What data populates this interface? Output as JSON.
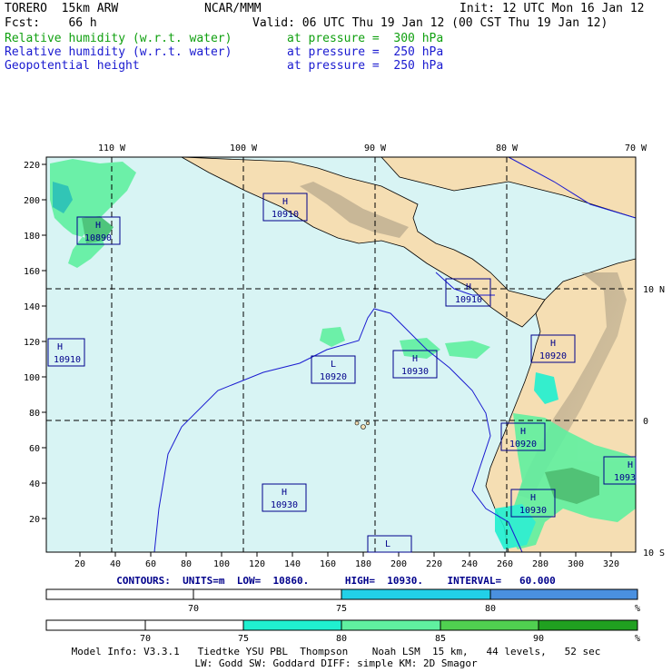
{
  "header": {
    "model": "TORERO  15km ARW",
    "org": "NCAR/MMM",
    "init": "Init: 12 UTC Mon 16 Jan 12",
    "fcst": "Fcst:    66 h",
    "valid": "Valid: 06 UTC Thu 19 Jan 12 (00 CST Thu 19 Jan 12)",
    "fields": [
      {
        "name": "Relative humidity (w.r.t. water)",
        "level": "at pressure =  300 hPa",
        "color": "#10a010"
      },
      {
        "name": "Relative humidity (w.r.t. water)",
        "level": "at pressure =  250 hPa",
        "color": "#1a1ad0"
      },
      {
        "name": "Geopotential height",
        "level": "at pressure =  250 hPa",
        "color": "#1a1ad0"
      }
    ]
  },
  "map": {
    "ocean_color": "#d8f4f4",
    "land_color": "#f5deb3",
    "top_lon_labels": [
      "110 W",
      "100 W",
      "90 W",
      "80 W",
      "70 W"
    ],
    "right_lat_labels": [
      "10 N",
      "0",
      "10 S"
    ],
    "left_ticks": [
      "220",
      "200",
      "180",
      "160",
      "140",
      "120",
      "100",
      "80",
      "60",
      "40",
      "20"
    ],
    "bottom_ticks": [
      "20",
      "40",
      "60",
      "80",
      "100",
      "120",
      "140",
      "160",
      "180",
      "200",
      "220",
      "240",
      "260",
      "280",
      "300",
      "320"
    ],
    "centers": [
      {
        "type": "H",
        "value": "10890"
      },
      {
        "type": "H",
        "value": "10910"
      },
      {
        "type": "H",
        "value": "10910"
      },
      {
        "type": "H",
        "value": "10910"
      },
      {
        "type": "L",
        "value": "10920"
      },
      {
        "type": "H",
        "value": "10930"
      },
      {
        "type": "H",
        "value": "10920"
      },
      {
        "type": "H",
        "value": "10920"
      },
      {
        "type": "H",
        "value": "10930"
      },
      {
        "type": "H",
        "value": "10930"
      },
      {
        "type": "H",
        "value": "1093"
      },
      {
        "type": "L",
        "value": ""
      }
    ]
  },
  "contours_line": "CONTOURS:  UNITS=m  LOW=  10860.      HIGH=  10930.    INTERVAL=   60.000",
  "colorbar_blue": {
    "labels": [
      "70",
      "75",
      "80",
      "%"
    ],
    "colors": [
      "#ffffff",
      "#ffffff",
      "#22d0e8",
      "#4a90e0"
    ]
  },
  "colorbar_green": {
    "labels": [
      "70",
      "75",
      "80",
      "85",
      "90",
      "%"
    ],
    "colors": [
      "#ffffff",
      "#ffffff",
      "#20f0d0",
      "#60f0a0",
      "#50d050",
      "#20a020"
    ]
  },
  "model_info_1": "Model Info: V3.3.1   Tiedtke YSU PBL  Thompson    Noah LSM  15 km,   44 levels,   52 sec",
  "model_info_2": "LW: Godd SW: Goddard DIFF: simple KM: 2D Smagor"
}
